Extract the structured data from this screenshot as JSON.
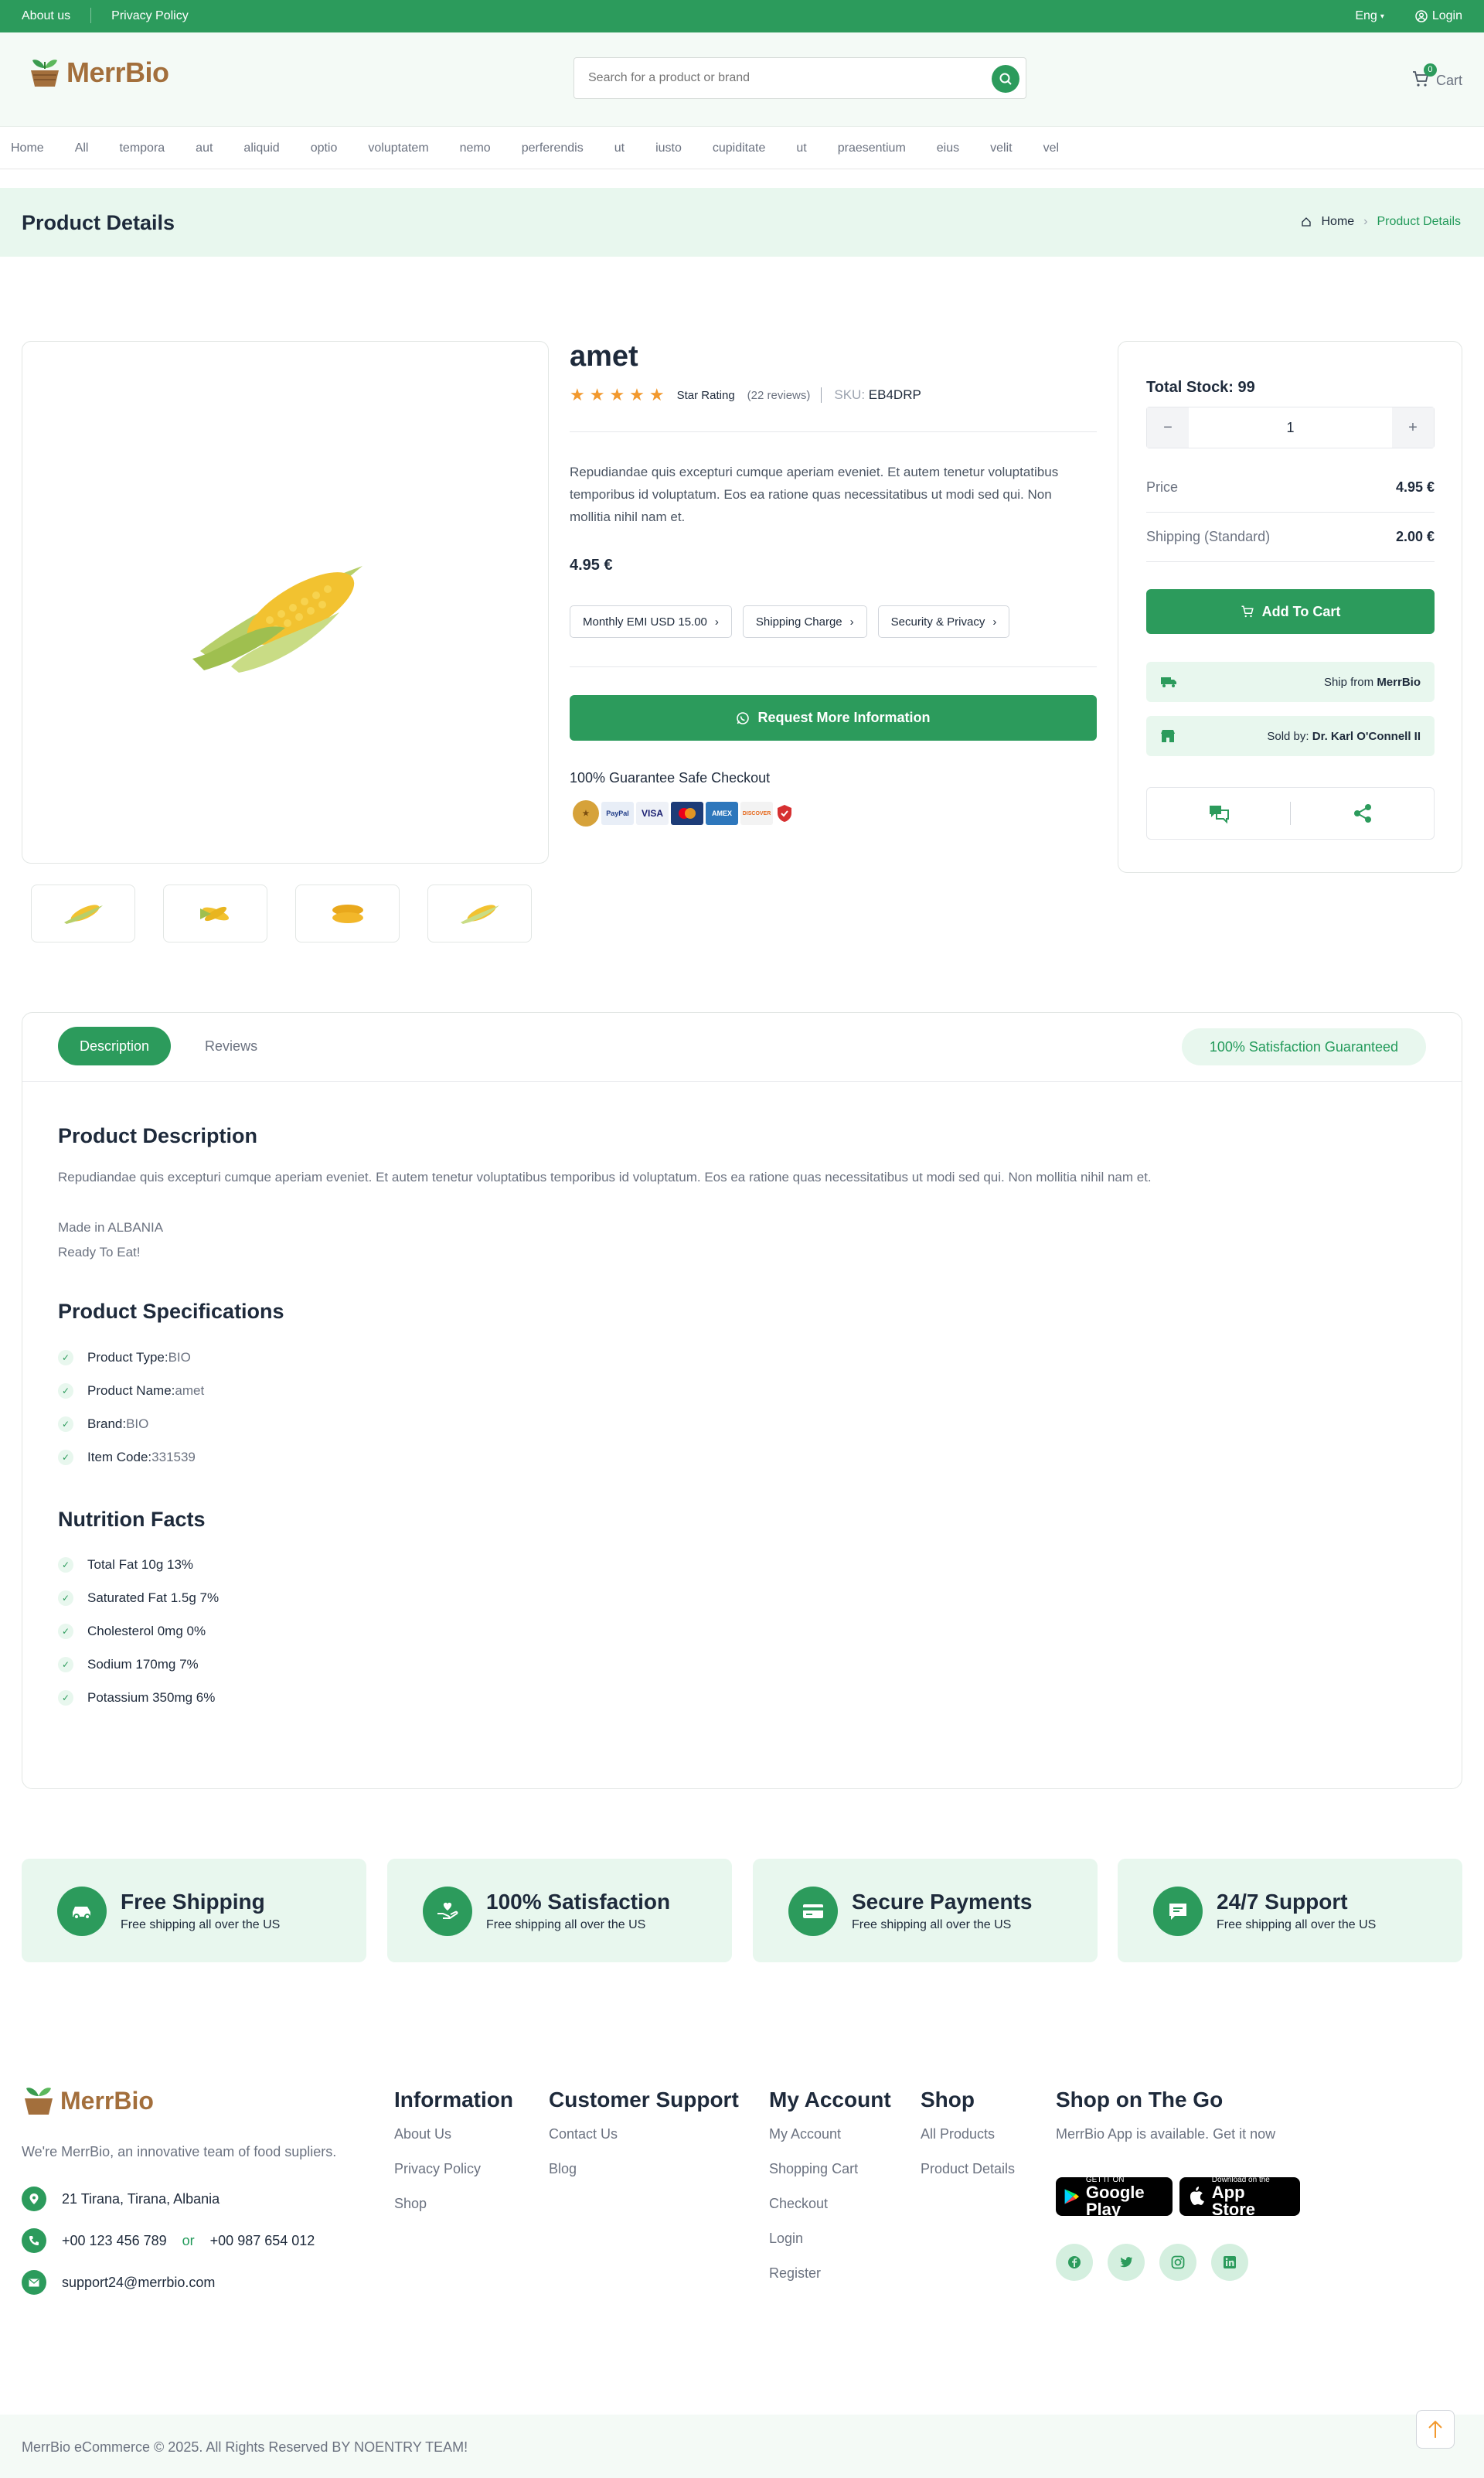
{
  "topbar": {
    "about": "About us",
    "privacy": "Privacy Policy",
    "lang": "Eng",
    "login": "Login"
  },
  "header": {
    "logo_text": "MerrBio",
    "search_placeholder": "Search for a product or brand",
    "cart_label": "Cart",
    "cart_count": "0"
  },
  "categories": [
    "Home",
    "All",
    "tempora",
    "aut",
    "aliquid",
    "optio",
    "voluptatem",
    "nemo",
    "perferendis",
    "ut",
    "iusto",
    "cupiditate",
    "ut",
    "praesentium",
    "eius",
    "velit",
    "vel"
  ],
  "page_title": "Product Details",
  "breadcrumb": {
    "home": "Home",
    "current": "Product Details"
  },
  "product": {
    "name": "amet",
    "rating_label": "Star Rating",
    "reviews": "(22 reviews)",
    "sku_label": "SKU:",
    "sku": "EB4DRP",
    "description": "Repudiandae quis excepturi cumque aperiam eveniet. Et autem tenetur voluptatibus temporibus id voluptatum. Eos ea ratione quas necessitatibus ut modi sed qui. Non mollitia nihil nam et.",
    "price": "4.95 €",
    "chips": [
      "Monthly EMI USD 15.00",
      "Shipping Charge",
      "Security & Privacy"
    ],
    "request_button": "Request More Information",
    "guarantee": "100% Guarantee Safe Checkout",
    "payment_methods": [
      "PayPal",
      "VISA",
      "Mastercard",
      "AMEX",
      "DISCOVER"
    ]
  },
  "side": {
    "stock": "Total Stock: 99",
    "qty": "1",
    "price_label": "Price",
    "price_value": "4.95 €",
    "shipping_label": "Shipping (Standard)",
    "shipping_value": "2.00 €",
    "add_to_cart": "Add To Cart",
    "ship_from_label": "Ship from",
    "ship_from": "MerrBio",
    "sold_by_label": "Sold by:",
    "sold_by": "Dr. Karl O'Connell II"
  },
  "tabs": {
    "description": "Description",
    "reviews": "Reviews",
    "satisfaction": "100% Satisfaction Guaranteed"
  },
  "description_section": {
    "title": "Product Description",
    "text": "Repudiandae quis excepturi cumque aperiam eveniet. Et autem tenetur voluptatibus temporibus id voluptatum. Eos ea ratione quas necessitatibus ut modi sed qui. Non mollitia nihil nam et.",
    "made_in": "Made in ALBANIA",
    "ready": "Ready To Eat!"
  },
  "specs": {
    "title": "Product Specifications",
    "items": [
      {
        "label": "Product Type:",
        "value": "BIO"
      },
      {
        "label": "Product Name:",
        "value": "amet"
      },
      {
        "label": "Brand:",
        "value": "BIO"
      },
      {
        "label": "Item Code:",
        "value": "331539"
      }
    ]
  },
  "nutrition": {
    "title": "Nutrition Facts",
    "items": [
      "Total Fat 10g 13%",
      "Saturated Fat 1.5g 7%",
      "Cholesterol 0mg 0%",
      "Sodium 170mg 7%",
      "Potassium 350mg 6%"
    ]
  },
  "features": [
    {
      "title": "Free Shipping",
      "text": "Free shipping all over the US"
    },
    {
      "title": "100% Satisfaction",
      "text": "Free shipping all over the US"
    },
    {
      "title": "Secure Payments",
      "text": "Free shipping all over the US"
    },
    {
      "title": "24/7 Support",
      "text": "Free shipping all over the US"
    }
  ],
  "footer": {
    "about": "We're MerrBio, an innovative team of food supliers.",
    "address": "21 Tirana, Tirana, Albania",
    "phone1": "+00 123 456 789",
    "or": "or",
    "phone2": "+00 987 654 012",
    "email": "support24@merrbio.com",
    "information": {
      "title": "Information",
      "links": [
        "About Us",
        "Privacy Policy",
        "Shop"
      ]
    },
    "support": {
      "title": "Customer Support",
      "links": [
        "Contact Us",
        "Blog"
      ]
    },
    "account": {
      "title": "My Account",
      "links": [
        "My Account",
        "Shopping Cart",
        "Checkout",
        "Login",
        "Register"
      ]
    },
    "shop": {
      "title": "Shop",
      "links": [
        "All Products",
        "Product Details"
      ]
    },
    "app": {
      "title": "Shop on The Go",
      "text": "MerrBio App is available. Get it now",
      "google_small": "GET IT ON",
      "google": "Google Play",
      "apple_small": "Download on the",
      "apple": "App Store"
    },
    "copyright": "MerrBio eCommerce © 2025. All Rights Reserved BY NOENTRY TEAM!"
  }
}
